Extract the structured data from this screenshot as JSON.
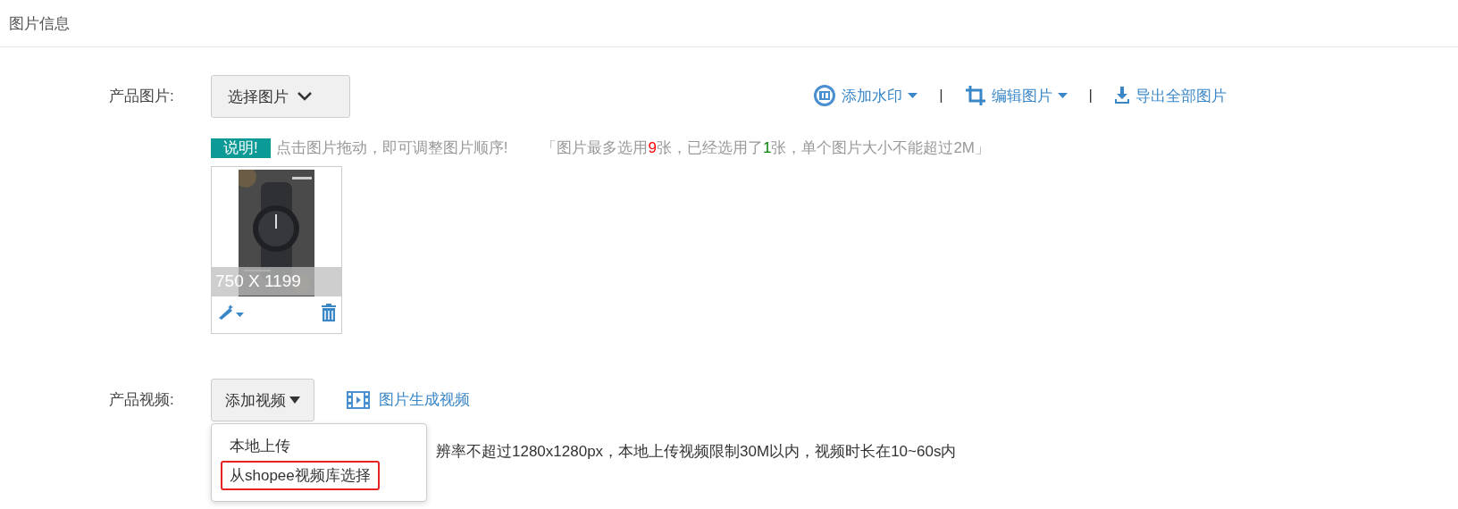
{
  "section_title": "图片信息",
  "images": {
    "label": "产品图片:",
    "select_button": "选择图片",
    "tools": [
      {
        "kind": "watermark",
        "label": "添加水印",
        "dropdown": true
      },
      {
        "kind": "crop",
        "label": "编辑图片",
        "dropdown": true
      },
      {
        "kind": "download",
        "label": "导出全部图片",
        "dropdown": false
      }
    ],
    "separator": "|",
    "note_badge": "说明!",
    "note": "点击图片拖动，即可调整图片顺序!",
    "limits": [
      {
        "text": "「图片最多选用"
      },
      {
        "text": "9",
        "color": "#ff0000"
      },
      {
        "text": "张，已经选用了"
      },
      {
        "text": "1",
        "color": "#008000"
      },
      {
        "text": "张，单个图片大小不能超过2M」"
      }
    ],
    "thumbnails": [
      {
        "kind": "picture",
        "size": "750 X 1199"
      }
    ]
  },
  "video": {
    "label": "产品视频:",
    "add_button": "添加视频",
    "generate_link": "图片生成视频",
    "hint": "辨率不超过1280x1280px，本地上传视频限制30M以内，视频时长在10~60s内",
    "menu": [
      {
        "label": "本地上传",
        "selected": false
      },
      {
        "label": "从shopee视频库选择",
        "selected": true
      }
    ]
  }
}
